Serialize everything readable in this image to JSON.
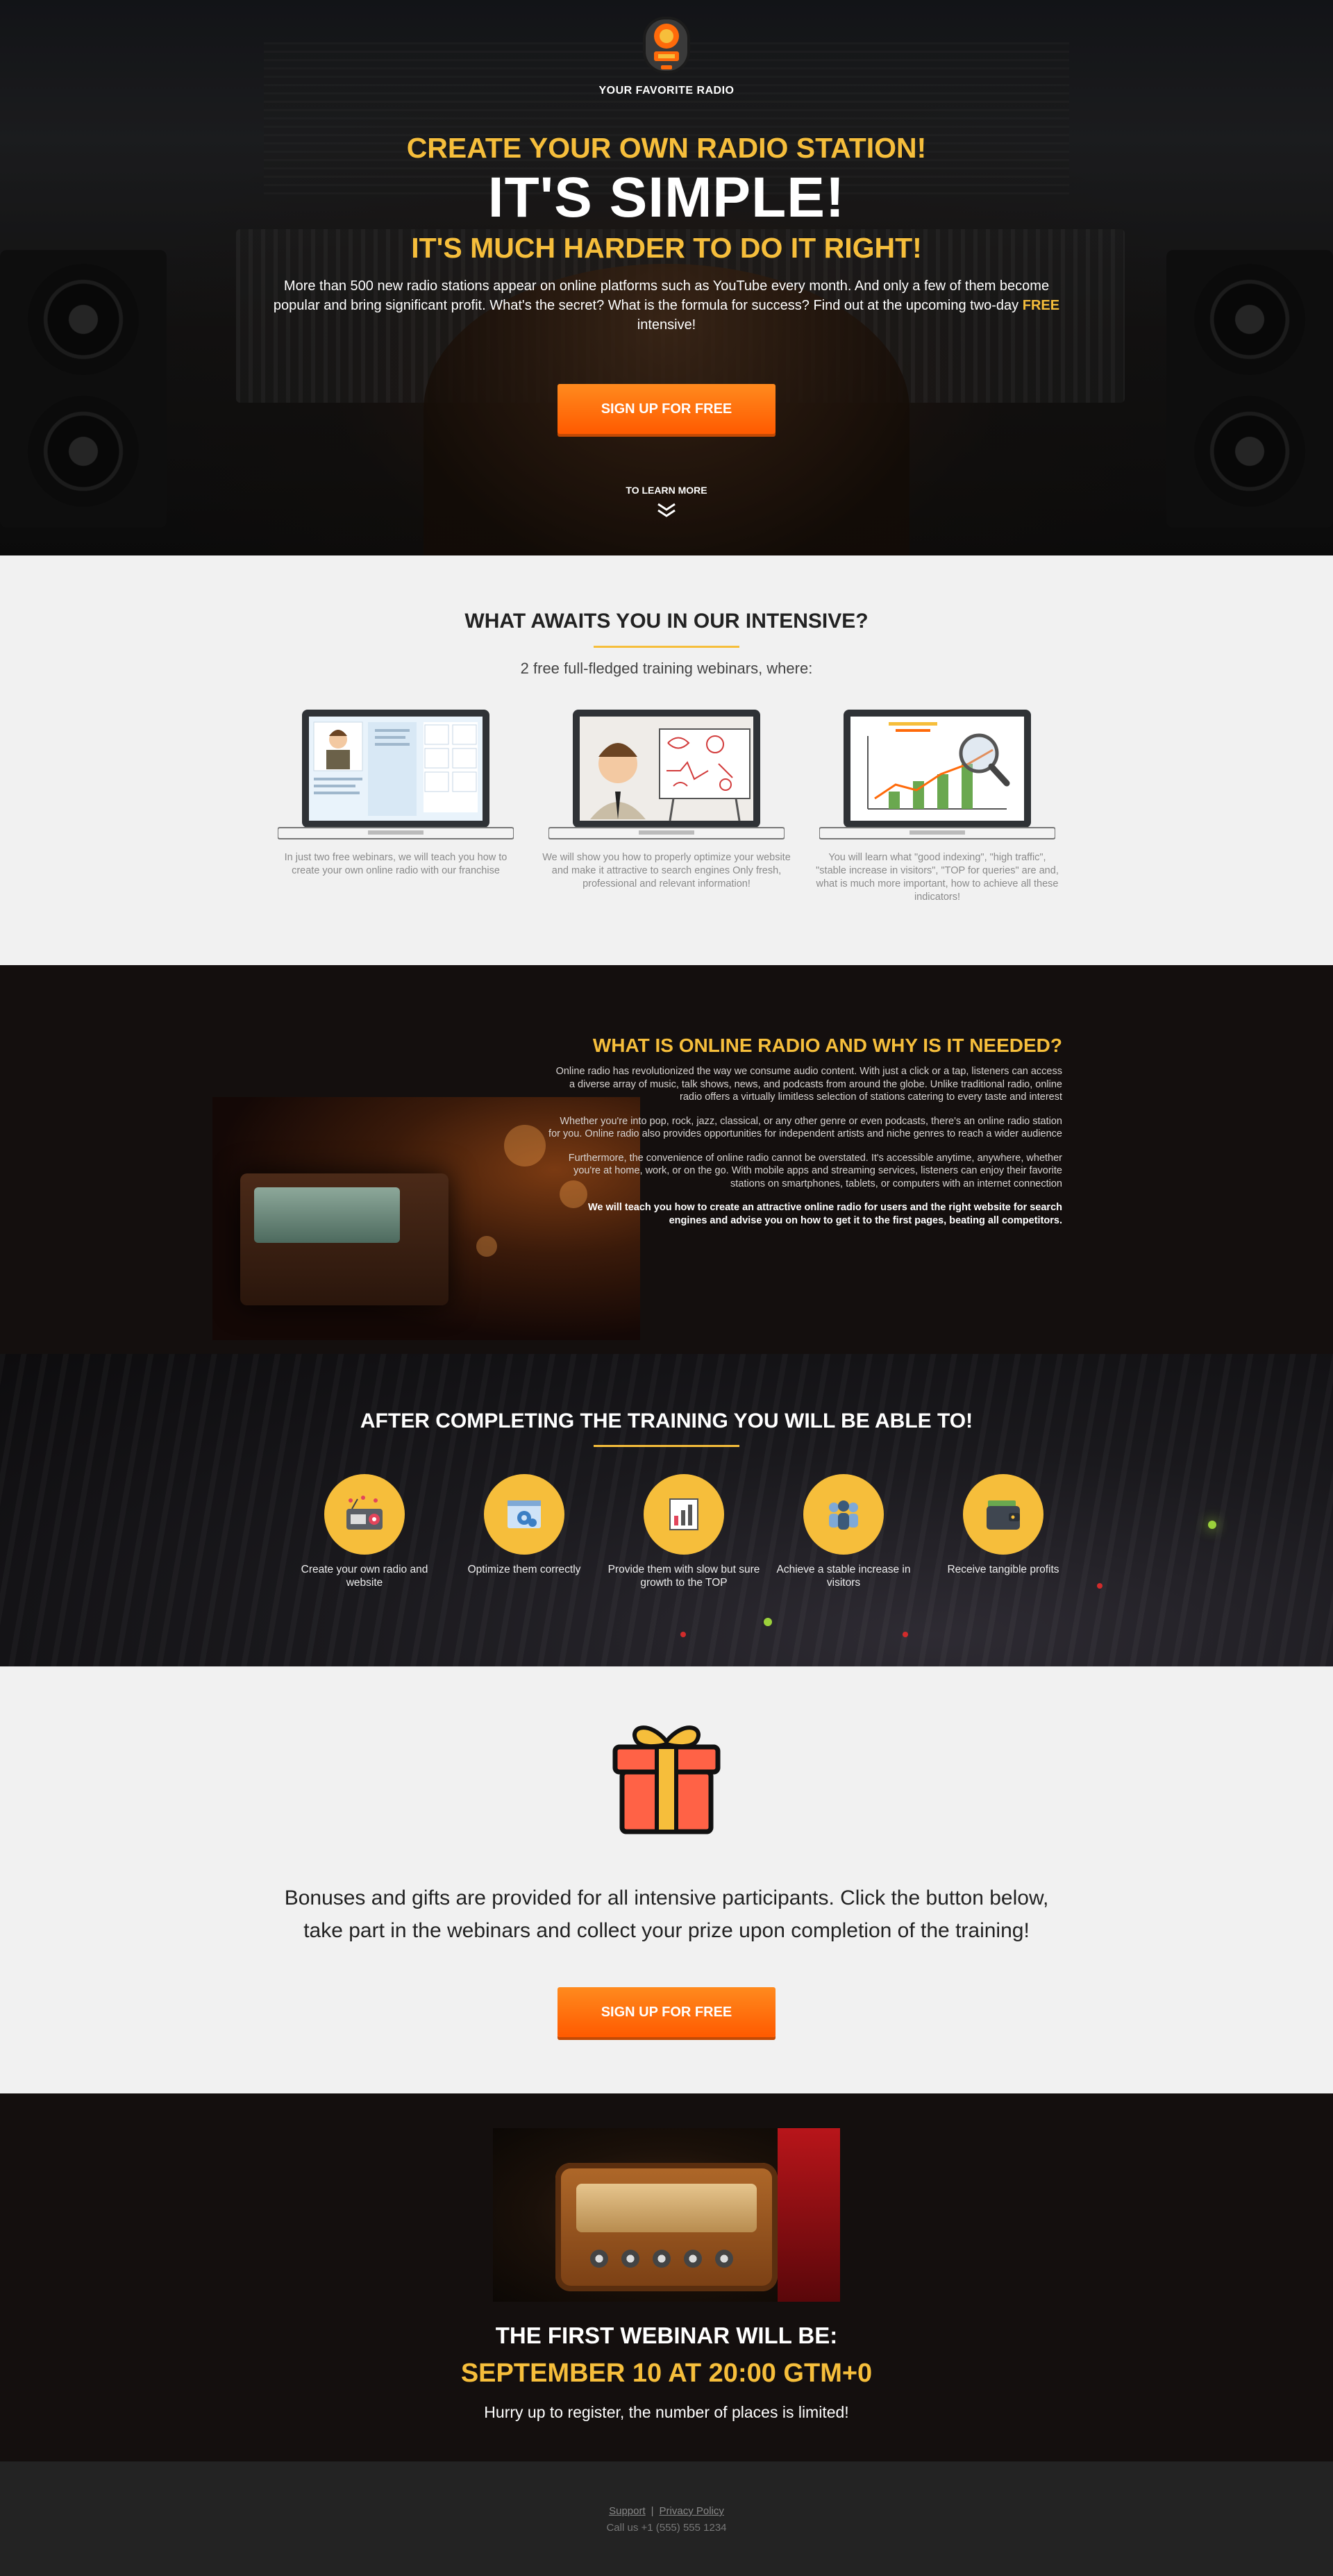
{
  "hero": {
    "logo_text": "YOUR FAVORITE RADIO",
    "kicker": "CREATE YOUR OWN RADIO STATION!",
    "headline": "IT'S SIMPLE!",
    "subheadline": "IT'S MUCH HARDER TO DO IT RIGHT!",
    "lead_before": "More than 500 new radio stations appear on online platforms such as YouTube every month. And only a few of them become popular and bring significant profit. What's the secret? What is the formula for success? Find out at the upcoming two-day ",
    "lead_highlight": "FREE",
    "lead_after": " intensive!",
    "cta_label": "SIGN UP FOR FREE",
    "learn_more": "TO LEARN MORE"
  },
  "awaits": {
    "title": "WHAT AWAITS YOU IN OUR INTENSIVE?",
    "subtitle": "2 free full-fledged training webinars, where:",
    "cards": [
      {
        "text": "In just two free webinars, we will teach you how to create your own online radio with our franchise"
      },
      {
        "text": "We will show you how to properly optimize your website and make it attractive to search engines Only fresh, professional and relevant information!"
      },
      {
        "text": "You will learn what \"good indexing\", \"high traffic\", \"stable increase in visitors\", \"TOP for queries\" are and, what is much more important, how to achieve all these indicators!"
      }
    ]
  },
  "online": {
    "title": "WHAT IS ONLINE RADIO AND WHY IS IT NEEDED?",
    "p1": "Online radio has revolutionized the way we consume audio content. With just a click or a tap, listeners can access a diverse array of music, talk shows, news, and podcasts from around the globe. Unlike traditional radio, online radio offers a virtually limitless selection of stations catering to every taste and interest",
    "p2": "Whether you're into pop, rock, jazz, classical, or any other genre or even podcasts, there's an online radio station for you. Online radio also provides opportunities for independent artists and niche genres to reach a wider audience",
    "p3": "Furthermore, the convenience of online radio cannot be overstated. It's accessible anytime, anywhere, whether you're at home, work, or on the go. With mobile apps and streaming services, listeners can enjoy their favorite stations on smartphones, tablets, or computers with an internet connection",
    "p4": "We will teach you how to create an attractive online radio for users and the right website for search engines and advise you on how to get it to the first pages, beating all competitors."
  },
  "after": {
    "title": "AFTER COMPLETING THE TRAINING YOU WILL BE ABLE TO!",
    "skills": [
      {
        "icon": "radio-icon",
        "label": "Create your own radio and website"
      },
      {
        "icon": "settings-window-icon",
        "label": "Optimize them correctly"
      },
      {
        "icon": "bar-chart-icon",
        "label": "Provide them with slow but sure growth to the TOP"
      },
      {
        "icon": "people-icon",
        "label": "Achieve a stable increase in visitors"
      },
      {
        "icon": "wallet-icon",
        "label": "Receive tangible profits"
      }
    ]
  },
  "bonus": {
    "text_line1": "Bonuses and gifts are provided for all intensive participants. Click the button below,",
    "text_line2": "take part in the webinars and collect your prize upon completion of the training!",
    "cta_label": "SIGN UP FOR FREE"
  },
  "webinar": {
    "title": "THE FIRST WEBINAR WILL BE:",
    "date": "SEPTEMBER 10 AT 20:00 GTM+0",
    "hurry": "Hurry up to register, the number of places is limited!"
  },
  "footer": {
    "support": "Support",
    "separator": "|",
    "privacy": "Privacy Policy",
    "phone": "Call us +1 (555) 555 1234"
  },
  "colors": {
    "accent": "#f6be3b",
    "cta": "#ff6a0a",
    "dark_bg": "#140f0e",
    "light_bg": "#f1f1f1"
  }
}
